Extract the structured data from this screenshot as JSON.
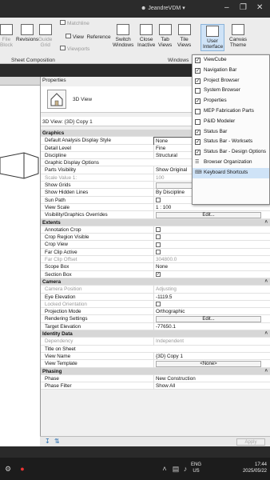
{
  "titlebar": {
    "user": "JeandreVDM"
  },
  "ribbon": {
    "buttons": [
      {
        "id": "file-block",
        "label": "File\nBlock",
        "dim": true
      },
      {
        "id": "revisions",
        "label": "Revisions"
      },
      {
        "id": "guide-grid",
        "label": "Guide\nGrid",
        "dim": true
      },
      {
        "id": "matchline",
        "label": "Matchline",
        "dim": true
      },
      {
        "id": "view-reference",
        "label": "View  Reference"
      },
      {
        "id": "viewports",
        "label": "Viewports",
        "dim": true
      },
      {
        "id": "switch-windows",
        "label": "Switch\nWindows"
      },
      {
        "id": "close-inactive",
        "label": "Close\nInactive"
      },
      {
        "id": "tab-views",
        "label": "Tab\nViews"
      },
      {
        "id": "tile-views",
        "label": "Tile\nViews"
      },
      {
        "id": "user-interface",
        "label": "User\nInterface"
      },
      {
        "id": "canvas-theme",
        "label": "Canvas\nTheme"
      }
    ],
    "groups": {
      "sheet_composition": "Sheet Composition",
      "windows": "Windows"
    }
  },
  "properties": {
    "title": "Properties",
    "type_label": "3D View",
    "selector": "3D View: {3D} Copy 1",
    "apply": "Apply",
    "rows": [
      {
        "type": "section",
        "k": "Graphics"
      },
      {
        "k": "Default Analysis Display Style",
        "v": "None",
        "box": true
      },
      {
        "k": "Detail Level",
        "v": "Fine"
      },
      {
        "k": "Discipline",
        "v": "Structural"
      },
      {
        "k": "Graphic Display Options",
        "v": ""
      },
      {
        "k": "Parts Visibility",
        "v": "Show Original"
      },
      {
        "k": "Scale Value    1:",
        "v": "100",
        "dis": true
      },
      {
        "k": "Show Grids",
        "btn": "Edit..."
      },
      {
        "k": "Show Hidden Lines",
        "v": "By Discipline"
      },
      {
        "k": "Sun Path",
        "chk": false
      },
      {
        "k": "View Scale",
        "v": "1 : 100"
      },
      {
        "k": "Visibility/Graphics Overrides",
        "btn": "Edit..."
      },
      {
        "type": "section",
        "k": "Extents"
      },
      {
        "k": "Annotation Crop",
        "chk": false
      },
      {
        "k": "Crop Region Visible",
        "chk": false
      },
      {
        "k": "Crop View",
        "chk": false
      },
      {
        "k": "Far Clip Active",
        "chk": false
      },
      {
        "k": "Far Clip Offset",
        "v": "304800.0",
        "dis": true
      },
      {
        "k": "Scope Box",
        "v": "None"
      },
      {
        "k": "Section Box",
        "chk": true
      },
      {
        "type": "section",
        "k": "Camera"
      },
      {
        "k": "Camera Position",
        "v": "Adjusting",
        "dis": true
      },
      {
        "k": "Eye Elevation",
        "v": "-1119.5"
      },
      {
        "k": "Locked Orientation",
        "chk": false,
        "dis": true
      },
      {
        "k": "Projection Mode",
        "v": "Orthographic"
      },
      {
        "k": "Rendering Settings",
        "btn": "Edit..."
      },
      {
        "k": "Target Elevation",
        "v": "-77650.1"
      },
      {
        "type": "section",
        "k": "Identity Data"
      },
      {
        "k": "Dependency",
        "v": "Independent",
        "dis": true
      },
      {
        "k": "Title on Sheet",
        "v": ""
      },
      {
        "k": "View Name",
        "v": "{3D} Copy 1"
      },
      {
        "k": "View Template",
        "btn": "<None>"
      },
      {
        "type": "section",
        "k": "Phasing"
      },
      {
        "k": "Phase",
        "v": "New Construction"
      },
      {
        "k": "Phase Filter",
        "v": "Show All"
      }
    ]
  },
  "menu": {
    "items": [
      {
        "label": "ViewCube",
        "checked": true
      },
      {
        "label": "Navigation Bar",
        "checked": true
      },
      {
        "label": "Project Browser",
        "checked": true
      },
      {
        "label": "System Browser",
        "checked": false
      },
      {
        "label": "Properties",
        "checked": true
      },
      {
        "label": "MEP Fabrication Parts",
        "checked": false
      },
      {
        "label": "P&ID Modeler",
        "checked": false
      },
      {
        "label": "Status Bar",
        "checked": true
      },
      {
        "label": "Status Bar - Worksets",
        "checked": true
      },
      {
        "label": "Status Bar - Design Options",
        "checked": true
      },
      {
        "label": "Browser Organization",
        "icon": "browser-organization-icon"
      },
      {
        "label": "Keyboard Shortcuts",
        "icon": "keyboard-icon",
        "highlighted": true
      }
    ]
  },
  "taskbar": {
    "lang1": "ENG",
    "lang2": "US",
    "time": "17:44",
    "date": "2025/05/22"
  },
  "colors": {
    "menu_highlight": "#cfe3f7",
    "section_bg": "#d7d7d7",
    "ribbon_bg": "#ececec"
  }
}
